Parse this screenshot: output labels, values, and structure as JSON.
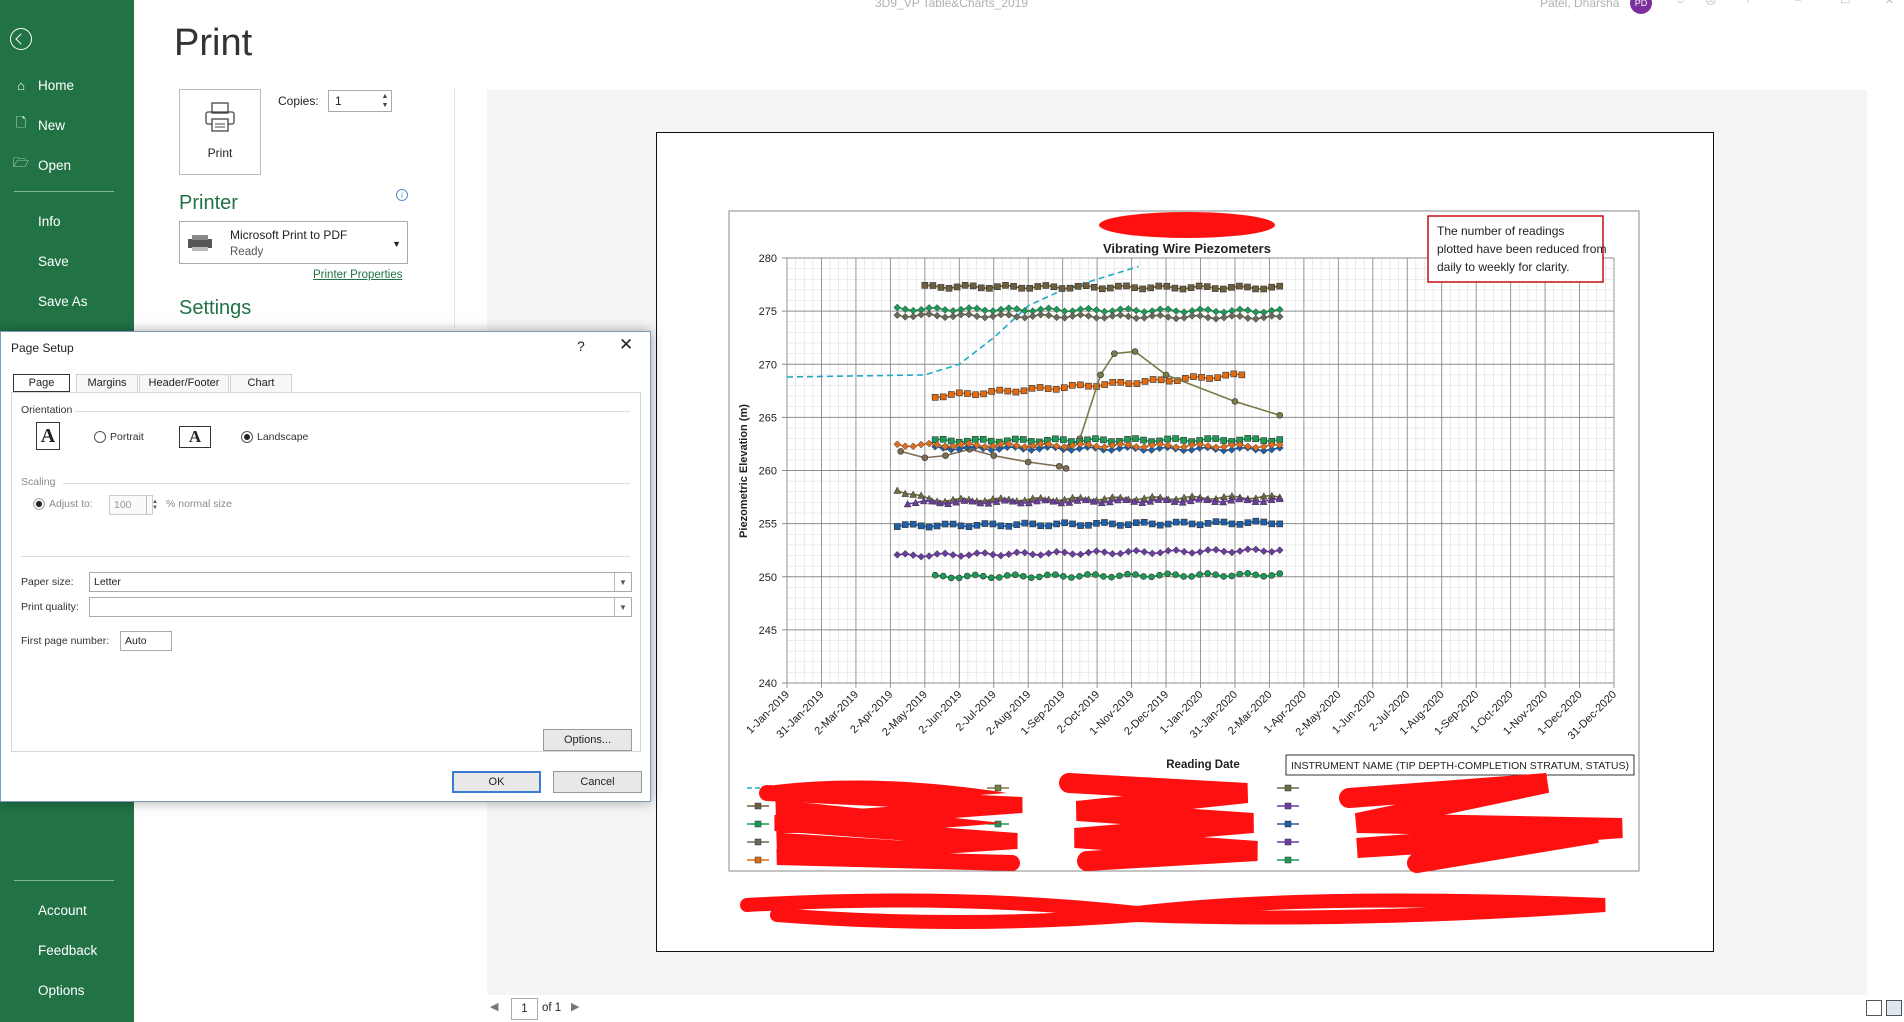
{
  "app": {
    "window_title": "3D9_VP Table&Charts_2019",
    "user_name": "Patel, Dharsha",
    "user_initials": "PD"
  },
  "nav": {
    "back_icon": "back-arrow-icon",
    "items": [
      {
        "label": "Home",
        "icon": "home-icon"
      },
      {
        "label": "New",
        "icon": "new-document-icon"
      },
      {
        "label": "Open",
        "icon": "folder-open-icon"
      },
      {
        "label": "Info"
      },
      {
        "label": "Save"
      },
      {
        "label": "Save As"
      }
    ],
    "bottom_items": [
      {
        "label": "Account"
      },
      {
        "label": "Feedback"
      },
      {
        "label": "Options"
      }
    ]
  },
  "print": {
    "title": "Print",
    "print_button_label": "Print",
    "copies_label": "Copies:",
    "copies_value": "1",
    "printer_heading": "Printer",
    "printer_name": "Microsoft Print to PDF",
    "printer_status": "Ready",
    "printer_properties_link": "Printer Properties",
    "settings_heading": "Settings"
  },
  "pager": {
    "current_page": "1",
    "of_label": "of 1"
  },
  "dialog": {
    "title": "Page Setup",
    "help": "?",
    "tabs": [
      "Page",
      "Margins",
      "Header/Footer",
      "Chart"
    ],
    "active_tab": "Page",
    "orientation_label": "Orientation",
    "portrait_label": "Portrait",
    "landscape_label": "Landscape",
    "orientation_selected": "Landscape",
    "scaling_label": "Scaling",
    "adjust_to_label": "Adjust to:",
    "adjust_value": "100",
    "normal_size_label": "% normal size",
    "paper_size_label": "Paper size:",
    "paper_size_value": "Letter",
    "print_quality_label": "Print quality:",
    "print_quality_value": "",
    "first_page_label": "First page number:",
    "first_page_value": "Auto",
    "options_button": "Options...",
    "ok_button": "OK",
    "cancel_button": "Cancel"
  },
  "chart_data": {
    "type": "line",
    "title": "Vibrating Wire Piezometers",
    "xlabel": "Reading Date",
    "ylabel": "Piezometric Elevation (m)",
    "ylim": [
      240,
      280
    ],
    "ytick_step": 5,
    "x_tick_labels": [
      "1-Jan-2019",
      "31-Jan-2019",
      "2-Mar-2019",
      "2-Apr-2019",
      "2-May-2019",
      "2-Jun-2019",
      "2-Jul-2019",
      "2-Aug-2019",
      "1-Sep-2019",
      "2-Oct-2019",
      "1-Nov-2019",
      "2-Dec-2019",
      "1-Jan-2020",
      "31-Jan-2020",
      "2-Mar-2020",
      "1-Apr-2020",
      "2-May-2020",
      "1-Jun-2020",
      "2-Jul-2020",
      "1-Aug-2020",
      "1-Sep-2020",
      "1-Oct-2020",
      "1-Nov-2020",
      "1-Dec-2020",
      "31-Dec-2020"
    ],
    "grid": true,
    "annotation": "The number of readings plotted have been reduced from daily to weekly for clarity.",
    "legend_box_label": "INSTRUMENT NAME (TIP DEPTH-COMPLETION STRATUM, STATUS)",
    "x_domain_months": [
      0,
      24
    ],
    "series": [
      {
        "color": "#1fa9c9",
        "marker": "none",
        "dashed": true,
        "x": [
          0,
          4,
          5,
          6,
          7,
          8,
          9,
          10,
          10.2
        ],
        "y": [
          268.8,
          269,
          270,
          272.5,
          275.5,
          277,
          278,
          279,
          279.2
        ]
      },
      {
        "color": "#6f5e3d",
        "marker": "square",
        "x": [
          4,
          14.3
        ],
        "y": [
          277.3,
          277.2
        ],
        "flat": true
      },
      {
        "color": "#1b9b55",
        "marker": "diamond",
        "x": [
          3.2,
          14.3
        ],
        "y": [
          275.2,
          275
        ],
        "flat": true
      },
      {
        "color": "#6b6b5a",
        "marker": "diamond",
        "x": [
          3.2,
          14.3
        ],
        "y": [
          274.6,
          274.4
        ],
        "flat": true
      },
      {
        "color": "#e06b12",
        "marker": "square",
        "x": [
          4.3,
          13.2
        ],
        "y": [
          267,
          269
        ],
        "flat": true
      },
      {
        "color": "#7b7b45",
        "marker": "circle",
        "x": [
          4.6,
          8.2,
          8.5,
          9.1,
          9.5,
          10.1,
          11,
          13,
          14.3
        ],
        "y": [
          262.2,
          262.2,
          263,
          269,
          271,
          271.2,
          269,
          266.5,
          265.2
        ]
      },
      {
        "color": "#7c6d50",
        "marker": "circle",
        "x": [
          3.3,
          4,
          4.6,
          5.3,
          6,
          7,
          7.9,
          8.1
        ],
        "y": [
          261.8,
          261.2,
          261.4,
          262,
          261.4,
          260.8,
          260.4,
          260.2
        ]
      },
      {
        "color": "#1b9b55",
        "marker": "square",
        "x": [
          4.3,
          14.3
        ],
        "y": [
          262.8,
          262.9
        ],
        "flat": true
      },
      {
        "color": "#1f5fa8",
        "marker": "diamond",
        "x": [
          4.3,
          14.3
        ],
        "y": [
          262.1,
          262
        ],
        "flat": true
      },
      {
        "color": "#e07020",
        "marker": "diamond",
        "x": [
          3.2,
          14.3
        ],
        "y": [
          262.4,
          262.3
        ],
        "flat": true
      },
      {
        "color": "#6b6b45",
        "marker": "triangle",
        "x": [
          3.2,
          4.2,
          14.3
        ],
        "y": [
          258.2,
          257.2,
          257.5
        ],
        "flat": true
      },
      {
        "color": "#6b3da0",
        "marker": "triangle",
        "x": [
          3.5,
          14.3
        ],
        "y": [
          257,
          257.2
        ],
        "flat": true
      },
      {
        "color": "#1f5fa8",
        "marker": "square",
        "x": [
          3.2,
          14.3
        ],
        "y": [
          254.8,
          255.1
        ],
        "flat": true
      },
      {
        "color": "#6b3da0",
        "marker": "diamond",
        "x": [
          3.2,
          14.3
        ],
        "y": [
          252,
          252.5
        ],
        "flat": true
      },
      {
        "color": "#1b9b55",
        "marker": "circle",
        "x": [
          4.3,
          14.3
        ],
        "y": [
          250,
          250.2
        ],
        "flat": true
      }
    ]
  }
}
